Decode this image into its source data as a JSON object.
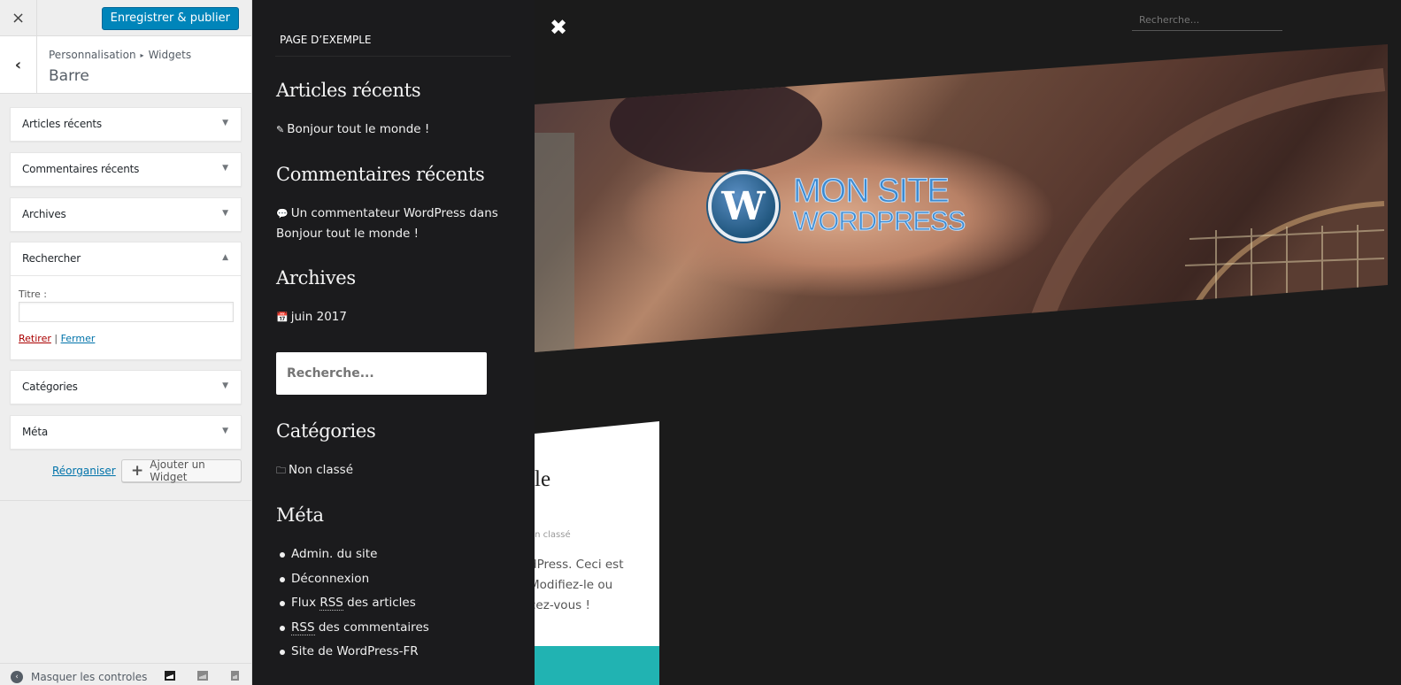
{
  "customizer": {
    "close_icon": "×",
    "publish_label": "Enregistrer & publier",
    "back_icon": "‹",
    "breadcrumb": [
      "Personnalisation",
      "Widgets"
    ],
    "breadcrumb_sep": "▸",
    "section_title": "Barre",
    "widgets": [
      {
        "title": "Articles récents",
        "expanded": false,
        "arrow": "▼"
      },
      {
        "title": "Commentaires récents",
        "expanded": false,
        "arrow": "▼"
      },
      {
        "title": "Archives",
        "expanded": false,
        "arrow": "▼"
      },
      {
        "title": "Rechercher",
        "expanded": true,
        "arrow": "▲",
        "fields": {
          "title_label": "Titre :",
          "title_value": ""
        },
        "remove_label": "Retirer",
        "action_sep": " | ",
        "close_label": "Fermer"
      },
      {
        "title": "Catégories",
        "expanded": false,
        "arrow": "▼"
      },
      {
        "title": "Méta",
        "expanded": false,
        "arrow": "▼"
      }
    ],
    "reorder_label": "Réorganiser",
    "add_widget_icon": "+",
    "add_widget_label": "Ajouter un Widget",
    "collapse_icon": "‹",
    "collapse_label": "Masquer les controles",
    "devices": [
      "desktop",
      "tablet",
      "mobile"
    ],
    "active_device": "desktop",
    "publish_color": "#0085ba"
  },
  "preview": {
    "page_link": "PAGE D’EXEMPLE",
    "menu_close_icon": "✖",
    "top_search_placeholder": "Recherche...",
    "widgets": {
      "recent_posts": {
        "title": "Articles récents",
        "icon": "✎",
        "items": [
          "Bonjour tout le monde !"
        ]
      },
      "recent_comments": {
        "title": "Commentaires récents",
        "icon": "💬",
        "line1": "Un commentateur WordPress dans",
        "line2": "Bonjour tout le monde !"
      },
      "archives": {
        "title": "Archives",
        "icon": "📅",
        "items": [
          "juin 2017"
        ]
      },
      "search": {
        "placeholder": "Recherche..."
      },
      "categories": {
        "title": "Catégories",
        "icon": "🗀",
        "items": [
          "Non classé"
        ]
      },
      "meta": {
        "title": "Méta",
        "items": [
          {
            "pre": "Admin. du site",
            "abbr": "",
            "post": ""
          },
          {
            "pre": "Déconnexion",
            "abbr": "",
            "post": ""
          },
          {
            "pre": "Flux ",
            "abbr": "RSS",
            "post": " des articles"
          },
          {
            "pre": "",
            "abbr": "RSS",
            "post": " des commentaires"
          },
          {
            "pre": "Site de WordPress-FR",
            "abbr": "",
            "post": ""
          }
        ]
      }
    },
    "logo": {
      "line1": "MON SITE",
      "line2": "WORDPRESS",
      "mark": "W"
    },
    "post": {
      "title_fragment": "le",
      "meta_fragment": "on classé",
      "excerpt_lines": [
        "dPress. Ceci est",
        "Modifiez-le ou",
        "cez-vous !"
      ]
    },
    "accent_color": "#21b3b2"
  }
}
